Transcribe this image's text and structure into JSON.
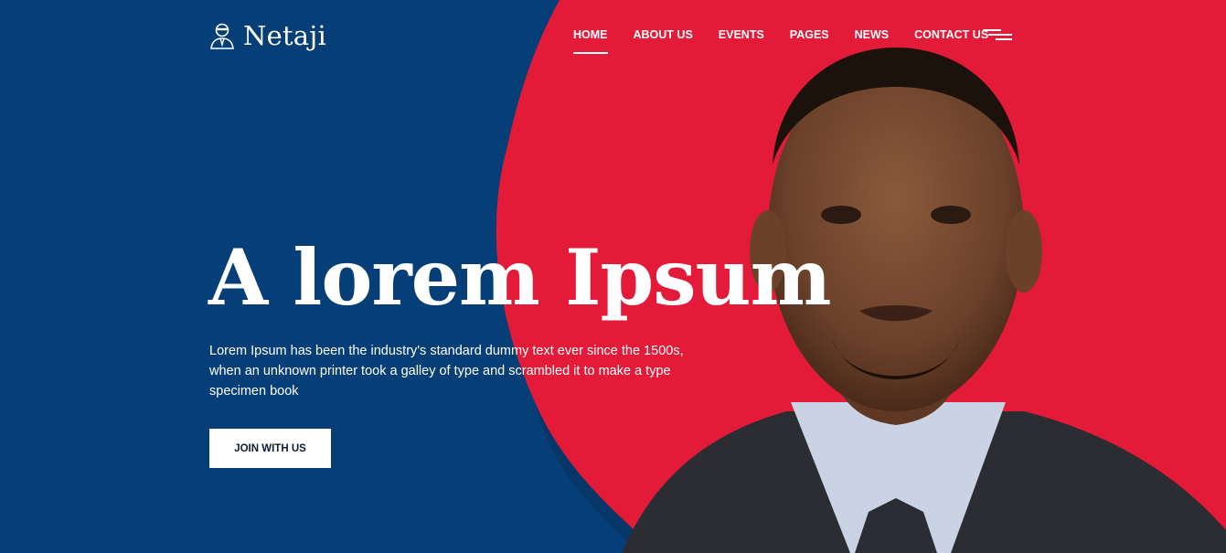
{
  "brand": {
    "name": "Netaji",
    "icon": "leader-avatar-icon"
  },
  "nav": {
    "items": [
      {
        "label": "HOME",
        "active": true
      },
      {
        "label": "ABOUT US",
        "active": false
      },
      {
        "label": "EVENTS",
        "active": false
      },
      {
        "label": "PAGES",
        "active": false
      },
      {
        "label": "NEWS",
        "active": false
      },
      {
        "label": "CONTACT US",
        "active": false
      }
    ],
    "menu_icon": "hamburger-menu-icon"
  },
  "hero": {
    "title": "A lorem Ipsum",
    "description": "Lorem Ipsum has been the industry's standard dummy text ever since the 1500s, when an unknown printer took a galley of type and scrambled it to make a type specimen book",
    "cta_label": "JOIN WITH US"
  },
  "colors": {
    "navy": "#063f77",
    "red": "#e31a38",
    "white": "#ffffff",
    "cta_text": "#0f1a33"
  }
}
